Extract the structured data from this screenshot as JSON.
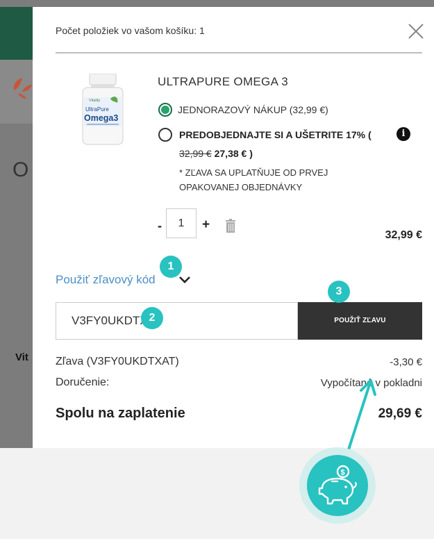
{
  "cart": {
    "header": "Počet položiek vo vašom košíku: 1",
    "product": {
      "name": "ULTRAPURE OMEGA 3",
      "option_one": "JEDNORAZOVÝ NÁKUP (32,99 €)",
      "option_two": "PREDOBJEDNAJTE SI A UŠETRITE 17% (",
      "option_two_close": ")",
      "old_price": "32,99 €",
      "new_price": "27,38 €",
      "note": "* ZĽAVA SA UPLATŇUJE OD PRVEJ OPAKOVANEJ OBJEDNÁVKY",
      "quantity": "1",
      "line_total": "32,99 €",
      "packshot": {
        "brand": "Vitality",
        "line1": "UltraPure",
        "line2": "Omega3"
      }
    },
    "promo": {
      "link_label": "Použiť zľavový kód",
      "code_value": "V3FY0UKDTXAT",
      "apply_label": "POUŽIŤ ZĽAVU"
    },
    "summary": {
      "discount_label": "Zľava (V3FY0UKDTXAT)",
      "discount_value": "-3,30 €",
      "delivery_label": "Doručenie:",
      "delivery_value": "Vypočítané v pokladni",
      "total_label": "Spolu na zaplatenie",
      "total_value": "29,69 €"
    }
  },
  "annotations": {
    "badge_1": "1",
    "badge_2": "2",
    "badge_3": "3"
  },
  "background": {
    "letter": "O",
    "vit_text": "Vit"
  },
  "icons": {
    "close": "close-icon",
    "info": "info-icon",
    "trash": "trash-icon",
    "chevron": "chevron-down-icon",
    "piggy": "piggy-bank-icon"
  },
  "colors": {
    "accent_teal": "#28c2c0",
    "link_blue": "#4d8ec7",
    "radio_green": "#27a36b",
    "button_dark": "#333333",
    "header_green": "#1f5a45"
  }
}
